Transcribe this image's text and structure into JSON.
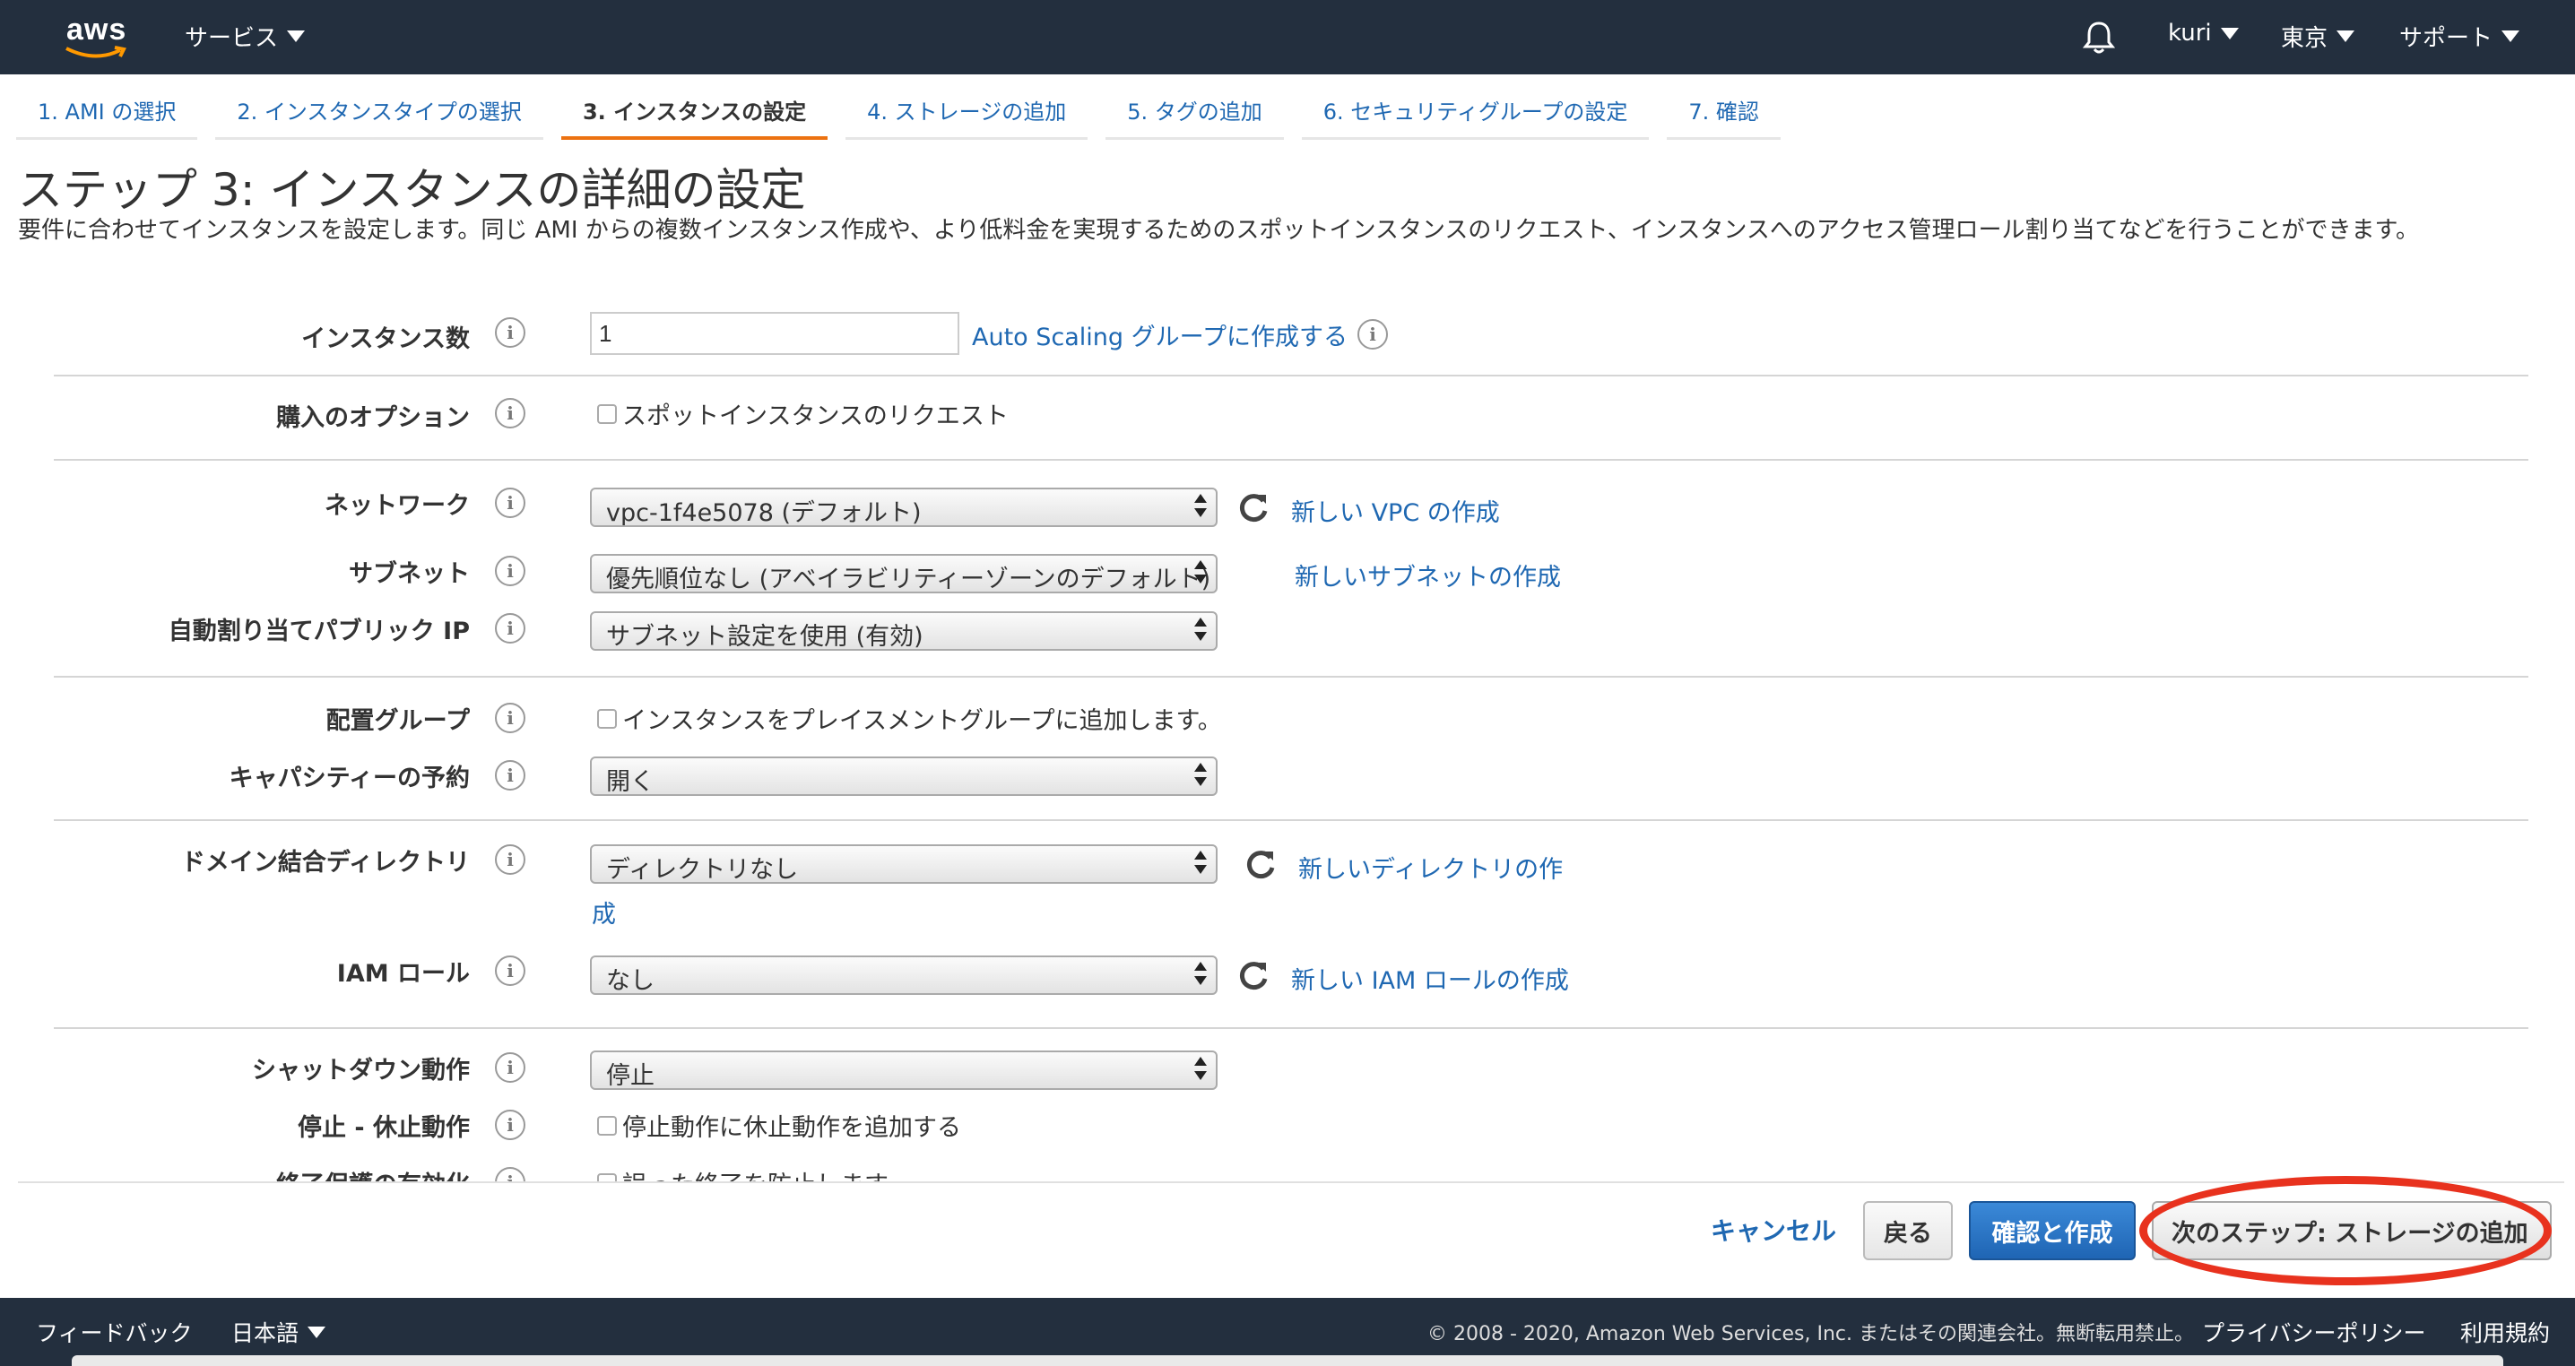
{
  "topbar": {
    "logo": "aws",
    "services": "サービス",
    "user": "kuri",
    "region": "東京",
    "support": "サポート"
  },
  "wizard": {
    "tabs": [
      {
        "label": "1. AMI の選択"
      },
      {
        "label": "2. インスタンスタイプの選択"
      },
      {
        "label": "3. インスタンスの設定"
      },
      {
        "label": "4. ストレージの追加"
      },
      {
        "label": "5. タグの追加"
      },
      {
        "label": "6. セキュリティグループの設定"
      },
      {
        "label": "7. 確認"
      }
    ],
    "active_index": 2
  },
  "page": {
    "title": "ステップ 3: インスタンスの詳細の設定",
    "description": "要件に合わせてインスタンスを設定します。同じ AMI からの複数インスタンス作成や、より低料金を実現するためのスポットインスタンスのリクエスト、インスタンスへのアクセス管理ロール割り当てなどを行うことができます。"
  },
  "form": {
    "instance_count": {
      "label": "インスタンス数",
      "value": "1",
      "link": "Auto Scaling グループに作成する"
    },
    "purchase_option": {
      "label": "購入のオプション",
      "checkbox": "スポットインスタンスのリクエスト"
    },
    "network": {
      "label": "ネットワーク",
      "value": "vpc-1f4e5078 (デフォルト)",
      "link": "新しい VPC の作成"
    },
    "subnet": {
      "label": "サブネット",
      "value": "優先順位なし (アベイラビリティーゾーンのデフォルト)",
      "link": "新しいサブネットの作成"
    },
    "public_ip": {
      "label": "自動割り当てパブリック IP",
      "value": "サブネット設定を使用 (有効)"
    },
    "placement_group": {
      "label": "配置グループ",
      "checkbox": "インスタンスをプレイスメントグループに追加します。"
    },
    "capacity_reservation": {
      "label": "キャパシティーの予約",
      "value": "開く"
    },
    "domain_directory": {
      "label": "ドメイン結合ディレクトリ",
      "value": "ディレクトリなし",
      "link": "新しいディレクトリの作",
      "link_wrap": "成"
    },
    "iam_role": {
      "label": "IAM ロール",
      "value": "なし",
      "link": "新しい IAM ロールの作成"
    },
    "shutdown_behavior": {
      "label": "シャットダウン動作",
      "value": "停止"
    },
    "stop_hibernate": {
      "label": "停止 - 休止動作",
      "checkbox": "停止動作に休止動作を追加する"
    },
    "termination_protection": {
      "label": "終了保護の有効化",
      "checkbox": "誤った終了を防止します"
    }
  },
  "actions": {
    "cancel": "キャンセル",
    "back": "戻る",
    "review": "確認と作成",
    "next": "次のステップ: ストレージの追加"
  },
  "footer": {
    "feedback": "フィードバック",
    "language": "日本語",
    "copyright": "© 2008 - 2020, Amazon Web Services, Inc. またはその関連会社。無断転用禁止。",
    "privacy": "プライバシーポリシー",
    "terms": "利用規約"
  },
  "colors": {
    "topbar": "#232f3e",
    "link": "#1f68b2",
    "accent": "#ec7211",
    "primary_button": "#1f65b4",
    "highlight": "#e8321e"
  }
}
